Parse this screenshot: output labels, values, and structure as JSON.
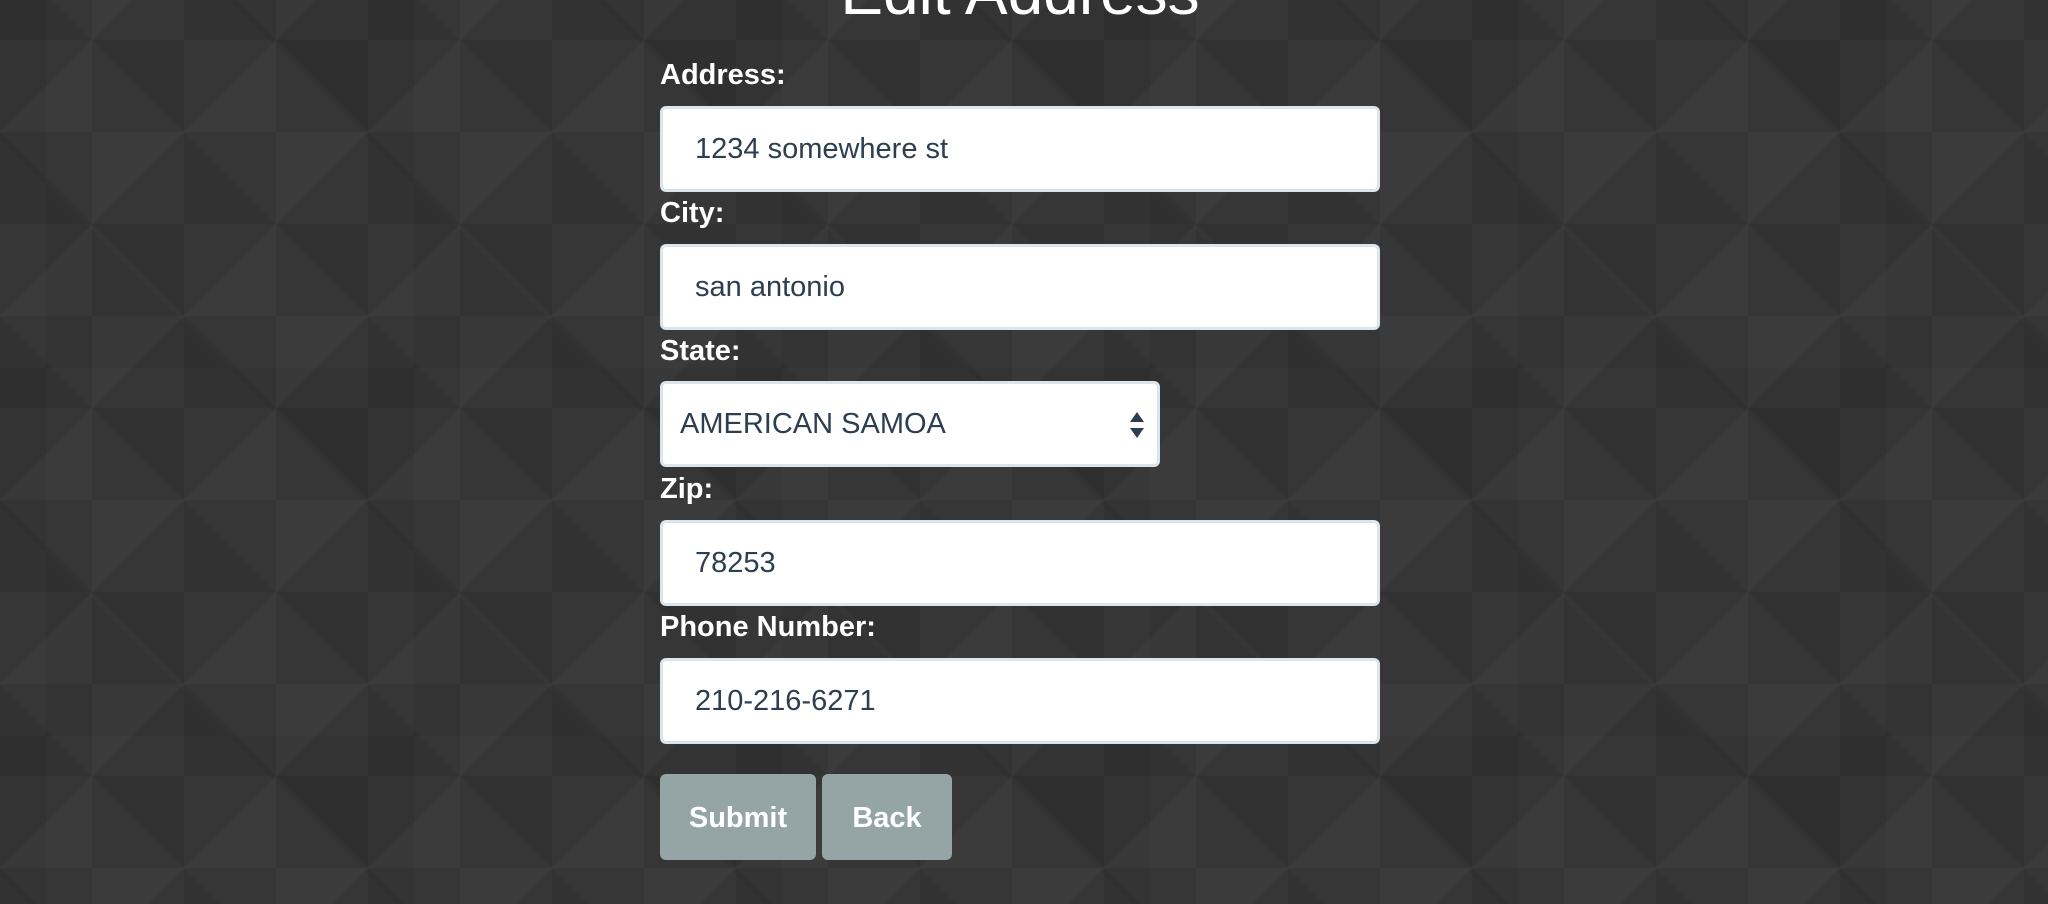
{
  "page": {
    "title": "Edit Address"
  },
  "form": {
    "address_label": "Address:",
    "address_value": "1234 somewhere st",
    "city_label": "City:",
    "city_value": "san antonio",
    "state_label": "State:",
    "state_value": "AMERICAN SAMOA",
    "zip_label": "Zip:",
    "zip_value": "78253",
    "phone_label": "Phone Number:",
    "phone_value": "210-216-6271"
  },
  "actions": {
    "submit_label": "Submit",
    "back_label": "Back"
  },
  "icons": {
    "select": "select-updown-arrows-icon"
  },
  "colors": {
    "background": "#353535",
    "input_text": "#2c3e50",
    "input_border": "#dce4ec",
    "button": "#95a5a6",
    "label": "#ffffff"
  }
}
